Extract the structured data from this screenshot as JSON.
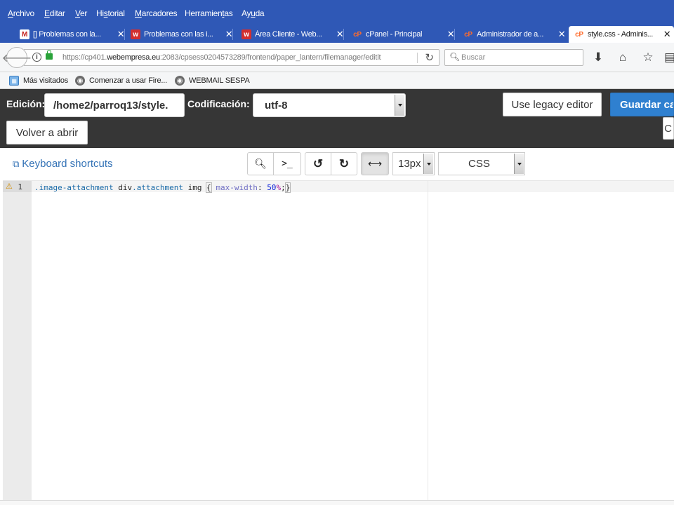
{
  "browser": {
    "menu": [
      {
        "pre": "",
        "ul": "A",
        "post": "rchivo"
      },
      {
        "pre": "",
        "ul": "E",
        "post": "ditar"
      },
      {
        "pre": "",
        "ul": "V",
        "post": "er"
      },
      {
        "pre": "Hi",
        "ul": "s",
        "post": "torial"
      },
      {
        "pre": "",
        "ul": "M",
        "post": "arcadores"
      },
      {
        "pre": "Herramien",
        "ul": "t",
        "post": "as"
      },
      {
        "pre": "Ay",
        "ul": "u",
        "post": "da"
      }
    ],
    "tabs": [
      {
        "label": "[] Problemas con la...",
        "icon": "gmail-icon",
        "glyph": "M"
      },
      {
        "label": "Problemas con las i...",
        "icon": "webempresa-icon",
        "glyph": "w"
      },
      {
        "label": "Área Cliente - Web...",
        "icon": "webempresa-icon",
        "glyph": "w"
      },
      {
        "label": "cPanel - Principal",
        "icon": "cpanel-icon",
        "glyph": "cP"
      },
      {
        "label": "Administrador de a...",
        "icon": "cpanel-icon",
        "glyph": "cP"
      },
      {
        "label": "style.css - Adminis...",
        "icon": "cpanel-icon",
        "glyph": "cP"
      }
    ],
    "url_prefix": "https://cp401.",
    "url_host": "webempresa.eu",
    "url_rest": ":2083/cpsess0204573289/frontend/paper_lantern/filemanager/editit",
    "search_placeholder": "Buscar",
    "bookmarks": [
      {
        "label": "Más visitados"
      },
      {
        "label": "Comenzar a usar Fire..."
      },
      {
        "label": "WEBMAIL SESPA"
      }
    ]
  },
  "cpanel": {
    "edicion_label": "Edición:",
    "file_path": "/home2/parroq13/style.",
    "codificacion_label": "Codificación:",
    "encoding": "utf-8",
    "legacy_button": "Use legacy editor",
    "save_button": "Guardar cambios",
    "reopen_button": "Volver a abrir",
    "hidden_button_fragment": "C"
  },
  "editor": {
    "keyboard_shortcuts": "Keyboard shortcuts",
    "font_size": "13px",
    "mode": "CSS",
    "line_number": "1",
    "code": {
      "selector": ".image-attachment",
      "element": "div",
      "class_sel": ".attachment",
      "tag": "img",
      "open": "{",
      "property": "max-width",
      "colon": ":",
      "number": "50",
      "unit": "%",
      "semicolon": ";",
      "close": "}"
    }
  }
}
